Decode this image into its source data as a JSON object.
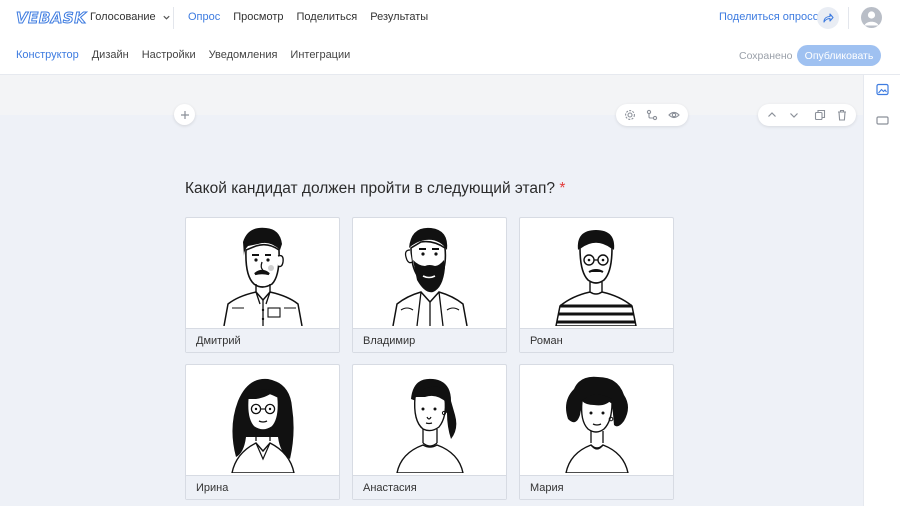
{
  "app": {
    "logo": "VEBASK",
    "project_name": "Голосование"
  },
  "nav": {
    "items": [
      "Опрос",
      "Просмотр",
      "Поделиться",
      "Результаты"
    ],
    "active": 0
  },
  "header_actions": {
    "share_survey_label": "Поделиться опросом",
    "share_icon": "share-arrow-icon",
    "avatar_icon": "user-avatar-icon"
  },
  "subnav": {
    "items": [
      "Конструктор",
      "Дизайн",
      "Настройки",
      "Уведомления",
      "Интеграции"
    ],
    "active": 0
  },
  "status": {
    "saved_label": "Сохранено",
    "publish_label": "Опубликовать"
  },
  "question": {
    "text": "Какой кандидат должен пройти в следующий этап?",
    "required_mark": "*",
    "options": [
      {
        "label": "Дмитрий",
        "image": "man-with-mustache-illustration"
      },
      {
        "label": "Владимир",
        "image": "bearded-man-illustration"
      },
      {
        "label": "Роман",
        "image": "man-with-glasses-striped-shirt-illustration"
      },
      {
        "label": "Ирина",
        "image": "woman-long-hair-glasses-illustration"
      },
      {
        "label": "Анастасия",
        "image": "woman-ponytail-illustration"
      },
      {
        "label": "Мария",
        "image": "woman-curly-hair-illustration"
      }
    ]
  },
  "colors": {
    "accent": "#3d7be0",
    "publish_bg": "#9fc1f1",
    "required": "#e23b3b",
    "canvas": "#eef1f7"
  }
}
